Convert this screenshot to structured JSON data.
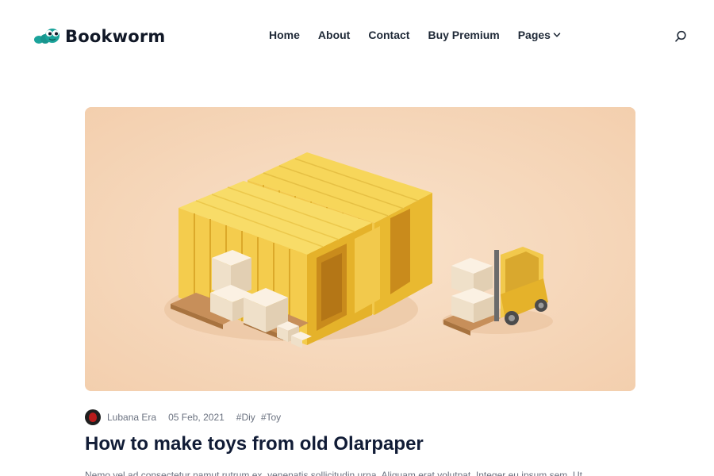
{
  "brand": {
    "name": "Bookworm"
  },
  "nav": {
    "items": [
      {
        "label": "Home"
      },
      {
        "label": "About"
      },
      {
        "label": "Contact"
      },
      {
        "label": "Buy Premium"
      },
      {
        "label": "Pages",
        "icon": "chevron-down-icon"
      }
    ]
  },
  "search": {
    "icon": "search-icon"
  },
  "post": {
    "author": "Lubana Era",
    "date": "05 Feb, 2021",
    "tags": [
      "#Diy",
      "#Toy"
    ],
    "title": "How to make toys from old Olarpaper",
    "excerpt": "Nemo vel ad consectetur namut rutrum ex, venenatis sollicitudin urna. Aliquam erat volutpat. Integer eu ipsum sem. Ut"
  },
  "colors": {
    "hero_background": "#f6d8bc",
    "container_yellow": "#f2c94c",
    "brand_teal": "#1aa39b",
    "title": "#111c36",
    "muted_text": "#6b7280"
  }
}
